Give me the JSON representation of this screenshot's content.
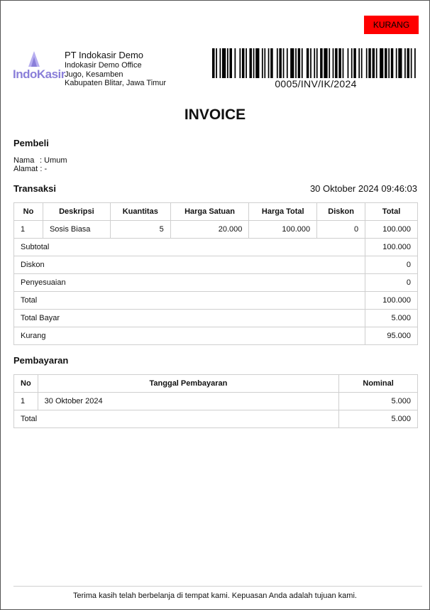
{
  "status": "KURANG",
  "logo": {
    "text": "IndoKasir"
  },
  "company": {
    "name": "PT Indokasir Demo",
    "office": "Indokasir Demo Office",
    "address1": "Jugo, Kesamben",
    "address2": "Kabupaten Blitar, Jawa Timur"
  },
  "invoice_number": "0005/INV/IK/2024",
  "title": "INVOICE",
  "buyer": {
    "section": "Pembeli",
    "name_label": "Nama",
    "name": "Umum",
    "address_label": "Alamat",
    "address": "-"
  },
  "transaction": {
    "section": "Transaksi",
    "date": "30 Oktober 2024 09:46:03",
    "headers": [
      "No",
      "Deskripsi",
      "Kuantitas",
      "Harga Satuan",
      "Harga Total",
      "Diskon",
      "Total"
    ],
    "rows": [
      [
        "1",
        "Sosis Biasa",
        "5",
        "20.000",
        "100.000",
        "0",
        "100.000"
      ]
    ],
    "summary": [
      {
        "label": "Subtotal",
        "value": "100.000"
      },
      {
        "label": "Diskon",
        "value": "0"
      },
      {
        "label": "Penyesuaian",
        "value": "0"
      },
      {
        "label": "Total",
        "value": "100.000"
      },
      {
        "label": "Total Bayar",
        "value": "5.000"
      },
      {
        "label": "Kurang",
        "value": "95.000"
      }
    ]
  },
  "payment": {
    "section": "Pembayaran",
    "headers": [
      "No",
      "Tanggal Pembayaran",
      "Nominal"
    ],
    "rows": [
      [
        "1",
        "30 Oktober 2024",
        "5.000"
      ]
    ],
    "total_label": "Total",
    "total_value": "5.000"
  },
  "footer": "Terima kasih telah berbelanja di tempat kami. Kepuasan Anda adalah tujuan kami."
}
